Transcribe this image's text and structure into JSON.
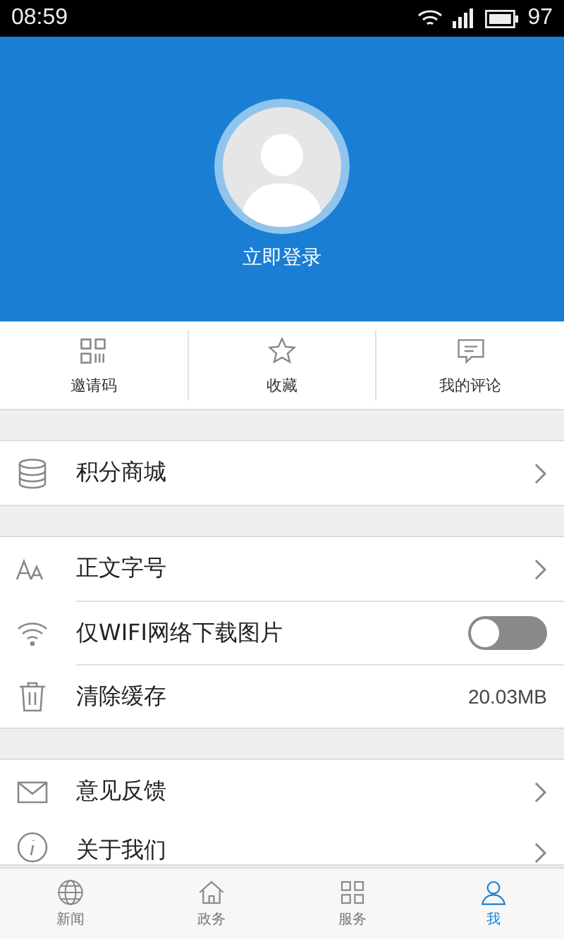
{
  "status_bar": {
    "time": "08:59",
    "battery": "97"
  },
  "profile": {
    "login_label": "立即登录"
  },
  "shortcuts": [
    {
      "kind": "qr",
      "label": "邀请码"
    },
    {
      "kind": "star",
      "label": "收藏"
    },
    {
      "kind": "comment",
      "label": "我的评论"
    }
  ],
  "groups": [
    {
      "items": [
        {
          "kind": "link",
          "label": "积分商城"
        }
      ]
    },
    {
      "items": [
        {
          "kind": "link",
          "label": "正文字号"
        },
        {
          "kind": "toggle",
          "label": "仅WIFI网络下载图片",
          "on": false
        },
        {
          "kind": "value",
          "label": "清除缓存",
          "value": "20.03MB"
        }
      ]
    },
    {
      "items": [
        {
          "kind": "link",
          "label": "意见反馈"
        },
        {
          "kind": "link",
          "label": "关于我们"
        }
      ]
    }
  ],
  "tab_bar": [
    {
      "label": "新闻",
      "selected": false
    },
    {
      "label": "政务",
      "selected": false
    },
    {
      "label": "服务",
      "selected": false
    },
    {
      "label": "我",
      "selected": true
    }
  ]
}
